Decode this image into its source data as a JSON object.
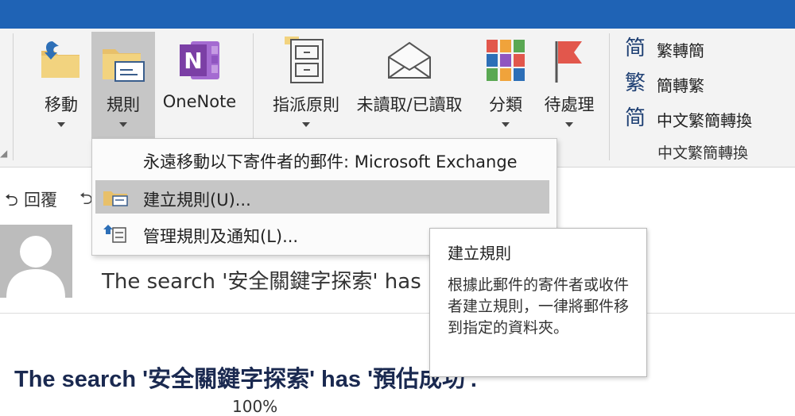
{
  "ribbon": {
    "move_label": "移動",
    "rules_label": "規則",
    "onenote_label": "OneNote",
    "assign_policy_label": "指派原則",
    "read_unread_label": "未讀取/已讀取",
    "categorize_label": "分類",
    "followup_label": "待處理",
    "chinese_group": {
      "to_simplified": "繁轉簡",
      "to_traditional": "簡轉繁",
      "convert": "中文繁簡轉換",
      "group_label": "中文繁簡轉換",
      "icon_simplified": "简",
      "icon_traditional": "繁",
      "icon_convert": "简"
    }
  },
  "rules_menu": {
    "always_move": "永遠移動以下寄件者的郵件: Microsoft Exchange",
    "create_rule": "建立規則(U)...",
    "manage_rules": "管理規則及通知(L)..."
  },
  "tooltip": {
    "title": "建立規則",
    "description": "根據此郵件的寄件者或收件者建立規則，一律將郵件移到指定的資料夾。"
  },
  "message": {
    "reply_label": "回覆",
    "subject_preview": "The search '安全關鍵字探索' has",
    "body_heading": "The search '安全關鍵字探索' has '預估成功'.",
    "body_cut": "100%"
  },
  "colors": {
    "titlebar": "#1f63b5",
    "onenote": "#7b3fa5",
    "flag": "#e2574c",
    "highlight": "#c6c6c6"
  },
  "icons": {
    "move": "folder-arrow-icon",
    "rules": "folder-envelope-icon",
    "onenote": "onenote-icon",
    "assign_policy": "file-cabinet-icon",
    "read_unread": "open-envelope-icon",
    "categorize": "color-grid-icon",
    "followup": "flag-icon"
  }
}
